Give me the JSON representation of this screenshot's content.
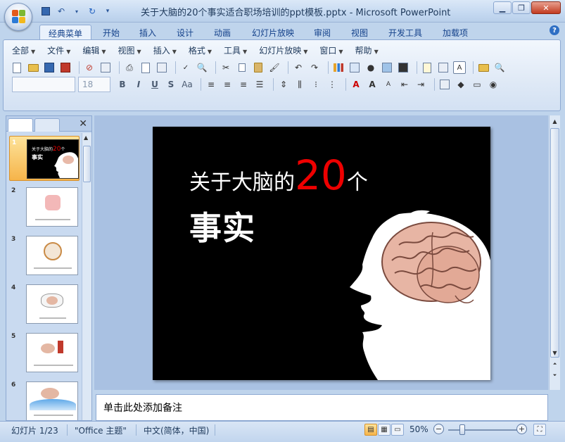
{
  "window": {
    "title": "关于大脑的20个事实适合职场培训的ppt模板.pptx - Microsoft PowerPoint"
  },
  "ribbon_tabs": [
    "经典菜单",
    "开始",
    "插入",
    "设计",
    "动画",
    "幻灯片放映",
    "审阅",
    "视图",
    "开发工具",
    "加载项"
  ],
  "active_tab": "经典菜单",
  "menu": [
    "全部",
    "文件",
    "编辑",
    "视图",
    "插入",
    "格式",
    "工具",
    "幻灯片放映",
    "窗口",
    "帮助"
  ],
  "font": {
    "name": "",
    "size": "18"
  },
  "format_buttons": [
    "B",
    "I",
    "U",
    "S",
    "Aa"
  ],
  "slide": {
    "line1_prefix": "关于大脑的",
    "line1_number": "20",
    "line1_suffix": "个",
    "line2": "事实"
  },
  "thumbnails": [
    {
      "num": "1",
      "selected": true
    },
    {
      "num": "2",
      "selected": false
    },
    {
      "num": "3",
      "selected": false
    },
    {
      "num": "4",
      "selected": false
    },
    {
      "num": "5",
      "selected": false
    },
    {
      "num": "6",
      "selected": false
    }
  ],
  "notes": {
    "placeholder": "单击此处添加备注"
  },
  "status": {
    "slide_counter": "幻灯片 1/23",
    "theme": "\"Office 主题\"",
    "language": "中文(简体，中国)",
    "zoom": "50%"
  },
  "colors": {
    "accent": "#e00000",
    "ribbon_bg": "#dfe9f6",
    "slide_bg": "#000000"
  }
}
